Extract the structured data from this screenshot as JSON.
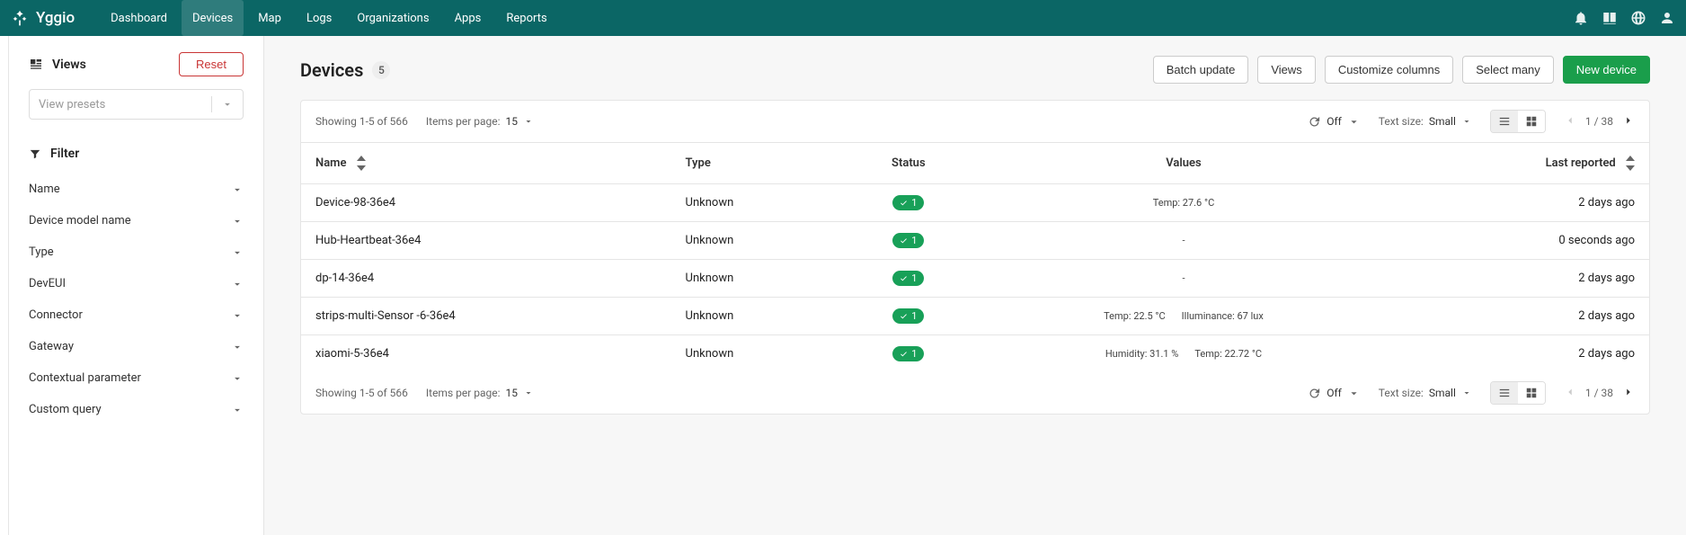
{
  "brand": "Yggio",
  "nav": {
    "items": [
      {
        "label": "Dashboard",
        "active": false
      },
      {
        "label": "Devices",
        "active": true
      },
      {
        "label": "Map",
        "active": false
      },
      {
        "label": "Logs",
        "active": false
      },
      {
        "label": "Organizations",
        "active": false
      },
      {
        "label": "Apps",
        "active": false
      },
      {
        "label": "Reports",
        "active": false
      }
    ]
  },
  "sidebar": {
    "views_title": "Views",
    "reset_label": "Reset",
    "view_presets_placeholder": "View presets",
    "filter_title": "Filter",
    "filters": [
      "Name",
      "Device model name",
      "Type",
      "DevEUI",
      "Connector",
      "Gateway",
      "Contextual parameter",
      "Custom query"
    ]
  },
  "page": {
    "title": "Devices",
    "count": "5",
    "actions": {
      "batch_update": "Batch update",
      "views": "Views",
      "customize_columns": "Customize columns",
      "select_many": "Select many",
      "new_device": "New device"
    }
  },
  "toolbar": {
    "showing": "Showing 1-5 of 566",
    "items_per_page_label": "Items per page:",
    "items_per_page_value": "15",
    "auto_refresh_label": "Off",
    "text_size_label": "Text size:",
    "text_size_value": "Small",
    "page_label": "1 / 38"
  },
  "table": {
    "columns": {
      "name": "Name",
      "type": "Type",
      "status": "Status",
      "values": "Values",
      "last_reported": "Last reported"
    },
    "rows": [
      {
        "name": "Device-98-36e4",
        "type": "Unknown",
        "status_count": "1",
        "values": [
          "Temp: 27.6 °C"
        ],
        "last_reported": "2 days ago"
      },
      {
        "name": "Hub-Heartbeat-36e4",
        "type": "Unknown",
        "status_count": "1",
        "values": [
          "-"
        ],
        "last_reported": "0 seconds ago"
      },
      {
        "name": "dp-14-36e4",
        "type": "Unknown",
        "status_count": "1",
        "values": [
          "-"
        ],
        "last_reported": "2 days ago"
      },
      {
        "name": "strips-multi-Sensor -6-36e4",
        "type": "Unknown",
        "status_count": "1",
        "values": [
          "Temp: 22.5 °C",
          "Illuminance: 67 lux"
        ],
        "last_reported": "2 days ago"
      },
      {
        "name": "xiaomi-5-36e4",
        "type": "Unknown",
        "status_count": "1",
        "values": [
          "Humidity: 31.1 %",
          "Temp: 22.72 °C"
        ],
        "last_reported": "2 days ago"
      }
    ]
  }
}
